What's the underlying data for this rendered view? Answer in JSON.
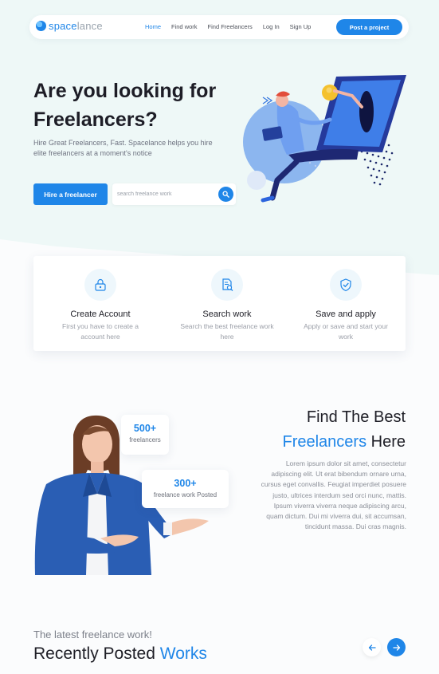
{
  "nav": {
    "brand_primary": "space",
    "brand_secondary": "lance",
    "links": [
      "Home",
      "Find work",
      "Find Freelancers",
      "Log In",
      "Sign Up"
    ],
    "active": "Home",
    "cta": "Post a project"
  },
  "hero": {
    "title": "Are you looking for Freelancers?",
    "subtitle": "Hire Great Freelancers, Fast. Spacelance helps you hire elite freelancers at a moment's notice",
    "hire_button": "Hire a freelancer",
    "search_placeholder": "search freelance work"
  },
  "features": [
    {
      "icon": "lock-icon",
      "title": "Create Account",
      "desc": "First you have to create a account  here"
    },
    {
      "icon": "document-search-icon",
      "title": "Search work",
      "desc": "Search the best freelance work here"
    },
    {
      "icon": "shield-check-icon",
      "title": "Save and apply",
      "desc": "Apply or save and start your work"
    }
  ],
  "stats": [
    {
      "value": "500+",
      "label": "freelancers"
    },
    {
      "value": "300+",
      "label": "freelance work Posted"
    }
  ],
  "find": {
    "title_line1": "Find The Best",
    "title_blue": "Freelancers",
    "title_rest": " Here",
    "body": "Lorem ipsum dolor sit amet, consectetur adipiscing elit. Ut erat bibendum ornare urna, cursus eget convallis. Feugiat imperdiet posuere justo, ultrices interdum sed orci nunc, mattis. Ipsum viverra viverra neque adipiscing arcu, quam dictum. Dui mi viverra dui, sit accumsan, tincidunt massa. Dui cras magnis."
  },
  "recent": {
    "subtitle": "The latest freelance work!",
    "title_dark": "Recently Posted ",
    "title_blue": "Works"
  },
  "colors": {
    "accent": "#1f86e8",
    "hero_bg": "#eef8f7",
    "text_dark": "#1e1e26"
  }
}
